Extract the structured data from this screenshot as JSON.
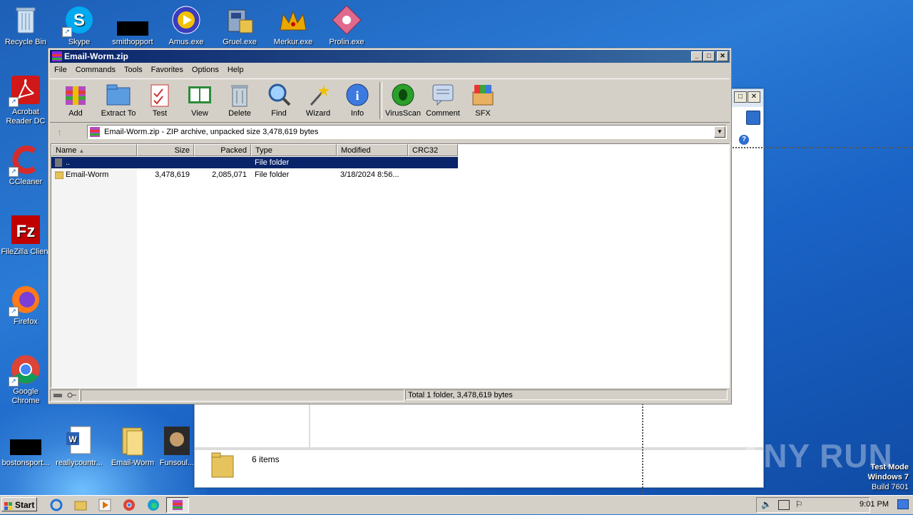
{
  "desktop": {
    "icons": [
      {
        "name": "recycle-bin-icon",
        "label": "Recycle Bin"
      },
      {
        "name": "skype-icon",
        "label": "Skype"
      },
      {
        "name": "smithopport-icon",
        "label": "smithopport"
      },
      {
        "name": "amus-exe-icon",
        "label": "Amus.exe"
      },
      {
        "name": "gruel-exe-icon",
        "label": "Gruel.exe"
      },
      {
        "name": "merkur-exe-icon",
        "label": "Merkur.exe"
      },
      {
        "name": "prolin-exe-icon",
        "label": "Prolin.exe"
      },
      {
        "name": "acrobat-reader-icon",
        "label": "Acrobat Reader DC"
      },
      {
        "name": "ccleaner-icon",
        "label": "CCleaner"
      },
      {
        "name": "filezilla-icon",
        "label": "FileZilla Client"
      },
      {
        "name": "firefox-icon",
        "label": "Firefox"
      },
      {
        "name": "chrome-icon",
        "label": "Google Chrome"
      },
      {
        "name": "bostonsport-icon",
        "label": "bostonsport..."
      },
      {
        "name": "reallycountr-icon",
        "label": "reallycountr..."
      },
      {
        "name": "email-worm-folder-icon",
        "label": "Email-Worm"
      },
      {
        "name": "funsoul-icon",
        "label": "Funsoul..."
      }
    ]
  },
  "back_window": {
    "status_items": "6 items"
  },
  "winrar": {
    "title": "Email-Worm.zip",
    "menu": [
      "File",
      "Commands",
      "Tools",
      "Favorites",
      "Options",
      "Help"
    ],
    "toolbar": [
      {
        "label": "Add",
        "icon": "add-icon"
      },
      {
        "label": "Extract To",
        "icon": "extract-icon"
      },
      {
        "label": "Test",
        "icon": "test-icon"
      },
      {
        "label": "View",
        "icon": "view-icon"
      },
      {
        "label": "Delete",
        "icon": "delete-icon"
      },
      {
        "label": "Find",
        "icon": "find-icon"
      },
      {
        "label": "Wizard",
        "icon": "wizard-icon"
      },
      {
        "label": "Info",
        "icon": "info-icon"
      },
      {
        "label": "VirusScan",
        "icon": "virusscan-icon"
      },
      {
        "label": "Comment",
        "icon": "comment-icon"
      },
      {
        "label": "SFX",
        "icon": "sfx-icon"
      }
    ],
    "address": "Email-Worm.zip - ZIP archive, unpacked size 3,478,619 bytes",
    "columns": [
      "Name",
      "Size",
      "Packed",
      "Type",
      "Modified",
      "CRC32"
    ],
    "rows": [
      {
        "name": "..",
        "size": "",
        "packed": "",
        "type": "File folder",
        "modified": "",
        "crc": ""
      },
      {
        "name": "Email-Worm",
        "size": "3,478,619",
        "packed": "2,085,071",
        "type": "File folder",
        "modified": "3/18/2024 8:56...",
        "crc": ""
      }
    ],
    "status": "Total 1 folder, 3,478,619 bytes"
  },
  "taskbar": {
    "start_label": "Start",
    "clock": "9:01 PM"
  },
  "watermark": {
    "line1": "Test Mode",
    "line2": "Windows 7",
    "line3": "Build 7601",
    "anyrun": "ANY RUN"
  },
  "colors": {
    "title_active": "#0a246a",
    "selection": "#0a246a",
    "desktop": "#1d5fb7"
  }
}
